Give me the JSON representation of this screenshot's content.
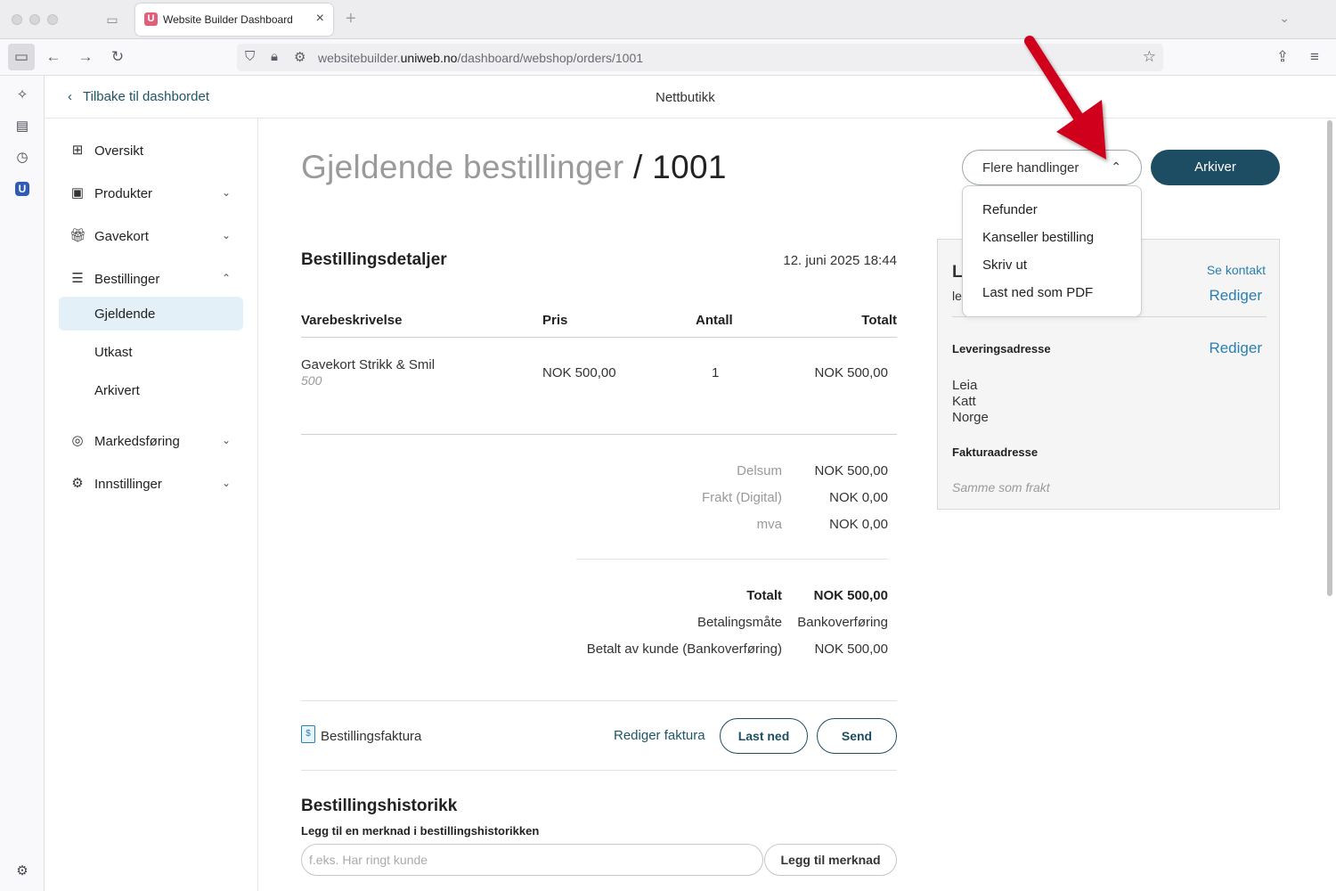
{
  "browser": {
    "tab_title": "Website Builder Dashboard",
    "tab_favicon_letter": "U",
    "url_prefix": "websitebuilder.",
    "url_domain": "uniweb.no",
    "url_path": "/dashboard/webshop/orders/1001"
  },
  "header": {
    "back_label": "Tilbake til dashbordet",
    "title": "Nettbutikk"
  },
  "nav": {
    "overview": "Oversikt",
    "products": "Produkter",
    "giftcards": "Gavekort",
    "orders": "Bestillinger",
    "current": "Gjeldende",
    "drafts": "Utkast",
    "archived": "Arkivert",
    "marketing": "Markedsføring",
    "settings": "Innstillinger"
  },
  "page": {
    "title_prefix": "Gjeldende bestillinger",
    "title_sep": " / ",
    "order_number": "1001",
    "more_actions": "Flere handlinger",
    "archive": "Arkiver",
    "dropdown": [
      "Refunder",
      "Kanseller bestilling",
      "Skriv ut",
      "Last ned som PDF"
    ]
  },
  "order": {
    "section_title": "Bestillingsdetaljer",
    "date": "12. juni 2025 18:44",
    "columns": {
      "description": "Varebeskrivelse",
      "price": "Pris",
      "quantity": "Antall",
      "total": "Totalt"
    },
    "item": {
      "name": "Gavekort Strikk & Smil",
      "sub": "500",
      "price": "NOK 500,00",
      "quantity": "1",
      "total": "NOK 500,00"
    },
    "subtotal_label": "Delsum",
    "subtotal_value": "NOK 500,00",
    "shipping_label": "Frakt (Digital)",
    "shipping_value": "NOK 0,00",
    "vat_label": "mva",
    "vat_value": "NOK 0,00",
    "total_label": "Totalt",
    "total_value": "NOK 500,00",
    "payment_label": "Betalingsmåte",
    "payment_value": "Bankoverføring",
    "paid_label": "Betalt av kunde (Bankoverføring)",
    "paid_value": "NOK 500,00"
  },
  "invoice": {
    "label": "Bestillingsfaktura",
    "edit": "Rediger faktura",
    "download": "Last ned",
    "send": "Send"
  },
  "history": {
    "title": "Bestillingshistorikk",
    "subtitle": "Legg til en merknad i bestillingshistorikken",
    "placeholder": "f.eks. Har ringt kunde",
    "add_note": "Legg til merknad"
  },
  "customer": {
    "name_partial": "L",
    "email_partial": "le",
    "see_contact": "Se kontakt",
    "edit": "Rediger",
    "shipping_title": "Leveringsadresse",
    "shipping_edit": "Rediger",
    "shipping_lines": [
      "Leia",
      "Katt",
      "Norge"
    ],
    "billing_title": "Fakturaadresse",
    "billing_same": "Samme som frakt"
  },
  "colors": {
    "primary": "#1d4d62",
    "link": "#2a7fb0",
    "annotation_arrow": "#d0021b"
  }
}
